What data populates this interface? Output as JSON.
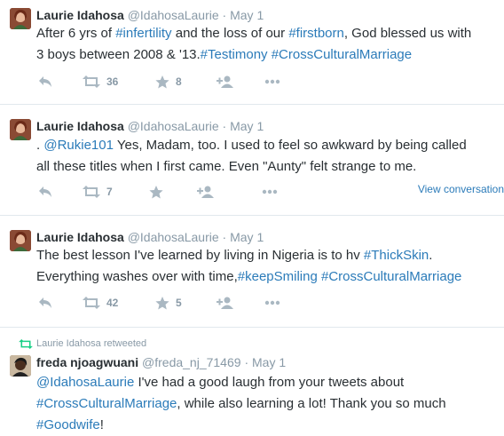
{
  "tweets": [
    {
      "name": "Laurie Idahosa",
      "handle": "@IdahosaLaurie",
      "separator": "·",
      "time": "May 1",
      "line1": [
        {
          "t": "After 6 yrs of ",
          "hl": false
        },
        {
          "t": "#infertility",
          "hl": true
        },
        {
          "t": " and the loss of our ",
          "hl": false
        },
        {
          "t": "#firstborn",
          "hl": true
        },
        {
          "t": ", God blessed us with",
          "hl": false
        }
      ],
      "line2": [
        {
          "t": "3 boys between 2008 & '13.",
          "hl": false
        },
        {
          "t": "#Testimony",
          "hl": true
        },
        {
          "t": " ",
          "hl": false
        },
        {
          "t": "#CrossCulturalMarriage",
          "hl": true
        }
      ],
      "retweets": "36",
      "favorites": "8"
    },
    {
      "name": "Laurie Idahosa",
      "handle": "@IdahosaLaurie",
      "separator": "·",
      "time": "May 1",
      "line1": [
        {
          "t": ". ",
          "hl": false
        },
        {
          "t": "@Rukie101",
          "hl": true
        },
        {
          "t": " Yes, Madam, too. I used to feel so awkward by being called",
          "hl": false
        }
      ],
      "line2": [
        {
          "t": "all these titles when I first came. Even \"Aunty\" felt strange to me.",
          "hl": false
        }
      ],
      "retweets": "7",
      "favorites": "",
      "view_conversation": "View conversation"
    },
    {
      "name": "Laurie Idahosa",
      "handle": "@IdahosaLaurie",
      "separator": "·",
      "time": "May 1",
      "line1": [
        {
          "t": "The best lesson I've learned by living in Nigeria is to hv ",
          "hl": false
        },
        {
          "t": "#ThickSkin",
          "hl": true
        },
        {
          "t": ".",
          "hl": false
        }
      ],
      "line2": [
        {
          "t": "Everything washes over with time,",
          "hl": false
        },
        {
          "t": "#keepSmiling",
          "hl": true
        },
        {
          "t": " ",
          "hl": false
        },
        {
          "t": "#CrossCulturalMarriage",
          "hl": true
        }
      ],
      "retweets": "42",
      "favorites": "5"
    },
    {
      "retweeted_by": "Laurie Idahosa retweeted",
      "name": "freda njoagwuani",
      "handle": "@freda_nj_71469",
      "separator": "·",
      "time": "May 1",
      "line1": [
        {
          "t": "@IdahosaLaurie",
          "hl": true
        },
        {
          "t": " I've had a good laugh from your tweets about",
          "hl": false
        }
      ],
      "line2": [
        {
          "t": "#CrossCulturalMarriage",
          "hl": true
        },
        {
          "t": ", while also learning a lot! Thank you so much",
          "hl": false
        }
      ],
      "line3": [
        {
          "t": "#Goodwife",
          "hl": true
        },
        {
          "t": "!",
          "hl": false
        }
      ]
    }
  ],
  "icons": {
    "reply": "reply-icon",
    "retweet": "retweet-icon",
    "favorite": "star-icon",
    "follow": "follow-icon",
    "more": "more-icon"
  },
  "colors": {
    "link": "#2b7bb9",
    "muted": "#8899a6",
    "icon": "#aab8c2",
    "retweet_green": "#19cf86"
  }
}
